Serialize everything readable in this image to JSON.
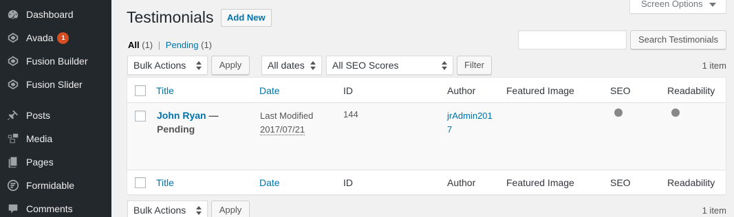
{
  "sidebar": {
    "items": [
      {
        "label": "Dashboard",
        "icon": "dashboard-icon"
      },
      {
        "label": "Avada",
        "icon": "avada-icon",
        "badge": "1"
      },
      {
        "label": "Fusion Builder",
        "icon": "fusion-builder-icon"
      },
      {
        "label": "Fusion Slider",
        "icon": "fusion-slider-icon"
      },
      {
        "label": "Posts",
        "icon": "pin-icon"
      },
      {
        "label": "Media",
        "icon": "media-icon"
      },
      {
        "label": "Pages",
        "icon": "pages-icon"
      },
      {
        "label": "Formidable",
        "icon": "formidable-icon"
      },
      {
        "label": "Comments",
        "icon": "comments-icon"
      }
    ]
  },
  "header": {
    "title": "Testimonials",
    "add_new": "Add New",
    "screen_options": "Screen Options"
  },
  "filters": {
    "all_label": "All",
    "all_count": "(1)",
    "separator": "|",
    "pending_label": "Pending",
    "pending_count": "(1)"
  },
  "search": {
    "placeholder": "",
    "button": "Search Testimonials"
  },
  "toolbar_top": {
    "bulk_actions": "Bulk Actions",
    "apply": "Apply",
    "dates": "All dates",
    "seo_scores": "All SEO Scores",
    "filter": "Filter",
    "items_count": "1 item"
  },
  "table": {
    "columns": [
      "Title",
      "Date",
      "ID",
      "Author",
      "Featured Image",
      "SEO",
      "Readability"
    ],
    "rows": [
      {
        "title": "John Ryan",
        "state": " — Pending",
        "date_label": "Last Modified",
        "date": "2017/07/21",
        "id": "144",
        "author": "jrAdmin2017"
      }
    ]
  },
  "toolbar_bottom": {
    "bulk_actions": "Bulk Actions",
    "apply": "Apply",
    "items_count": "1 item"
  },
  "colors": {
    "sidebar_bg": "#23282d",
    "link": "#0073aa",
    "badge": "#d54e21",
    "status_dot": "#888888"
  }
}
